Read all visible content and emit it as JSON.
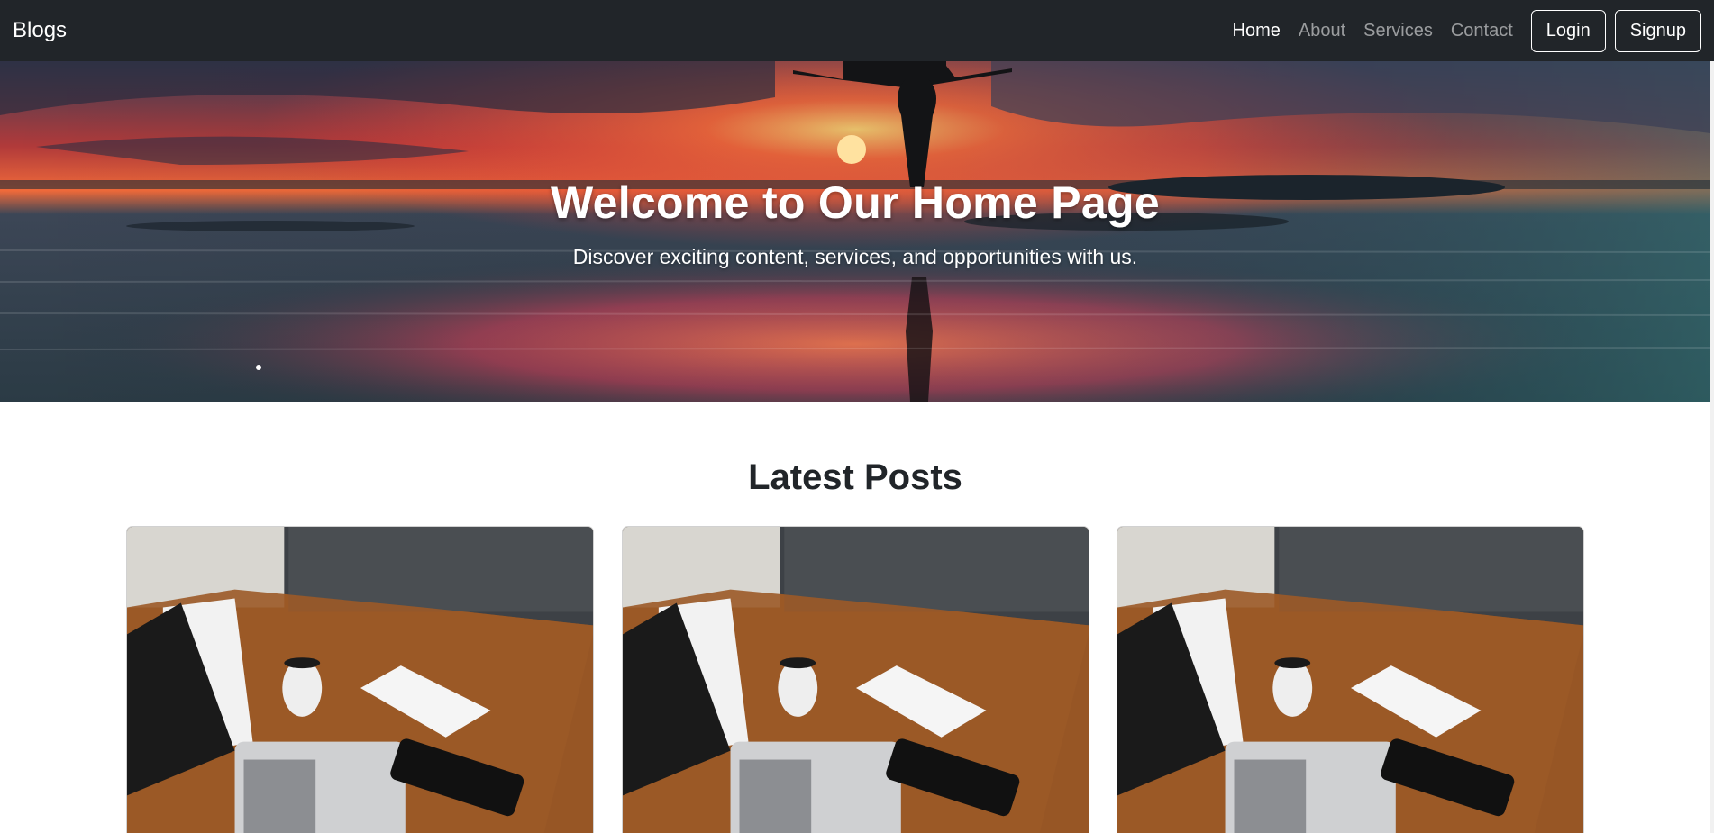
{
  "navbar": {
    "brand": "Blogs",
    "links": [
      {
        "label": "Home",
        "active": true
      },
      {
        "label": "About",
        "active": false
      },
      {
        "label": "Services",
        "active": false
      },
      {
        "label": "Contact",
        "active": false
      }
    ],
    "login_label": "Login",
    "signup_label": "Signup"
  },
  "hero": {
    "title": "Welcome to Our Home Page",
    "subtitle": "Discover exciting content, services, and opportunities with us."
  },
  "latest_posts": {
    "heading": "Latest Posts",
    "cards": [
      {
        "image": "desk-laptop-coffee-photo"
      },
      {
        "image": "desk-laptop-coffee-photo"
      },
      {
        "image": "desk-laptop-coffee-photo"
      }
    ]
  },
  "colors": {
    "navbar_bg": "#212529",
    "nav_text_active": "#ffffff",
    "nav_text_muted": "rgba(255,255,255,0.55)"
  }
}
